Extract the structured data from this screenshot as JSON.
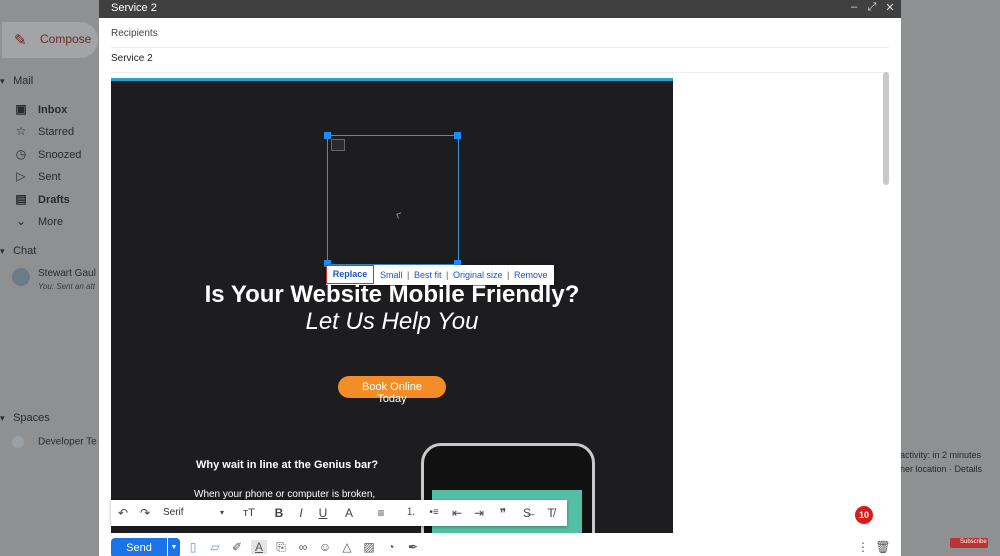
{
  "sidebar": {
    "compose": "Compose",
    "mail_header": "Mail",
    "items": [
      {
        "label": "Inbox",
        "icon": "inbox-icon",
        "glyph": "▣"
      },
      {
        "label": "Starred",
        "icon": "star-icon",
        "glyph": "☆"
      },
      {
        "label": "Snoozed",
        "icon": "clock-icon",
        "glyph": "◷"
      },
      {
        "label": "Sent",
        "icon": "send-icon",
        "glyph": "▷"
      },
      {
        "label": "Drafts",
        "icon": "draft-icon",
        "glyph": "▤"
      },
      {
        "label": "More",
        "icon": "chevron-down-icon",
        "glyph": "⌄"
      }
    ],
    "chat_header": "Chat",
    "chat_user": {
      "name": "Stewart Gaul",
      "preview": "You: Sent an att"
    },
    "spaces_header": "Spaces",
    "space_item": "Developer Te"
  },
  "right_notes": {
    "activity": "activity: in 2 minutes",
    "location": "her location · Details"
  },
  "youtube_badge": "Subscribe",
  "compose": {
    "title": "Service 2",
    "recipients_placeholder": "Recipients",
    "subject": "Service 2",
    "image_menu": {
      "replace": "Replace",
      "small": "Small",
      "best_fit": "Best fit",
      "original_size": "Original size",
      "remove": "Remove"
    },
    "email": {
      "headline": "Is Your Website Mobile Friendly?",
      "subheadline": "Let Us Help You",
      "cta_line1": "Book Online",
      "cta_line2": "Today",
      "section_title": "Why wait in line at the Genius bar?",
      "paragraph": "When your phone or computer is broken,"
    },
    "format_bar": {
      "undo": "↶",
      "redo": "↷",
      "font": "Serif",
      "font_arrow": "▾",
      "size": "тT",
      "bold": "B",
      "italic": "I",
      "underline": "U",
      "color": "A",
      "align": "≡",
      "numbered": "⒈",
      "bullets": "•≡",
      "indent_less": "⇤",
      "indent_more": "⇥",
      "quote": "❞",
      "strike": "S̶",
      "clear": "T̸"
    },
    "notification_count": "10",
    "send": "Send"
  },
  "colors": {
    "accent": "#1a73e8",
    "cta": "#f48d26",
    "email_bg": "#1d1c1e",
    "highlight": "#d32a2a"
  }
}
